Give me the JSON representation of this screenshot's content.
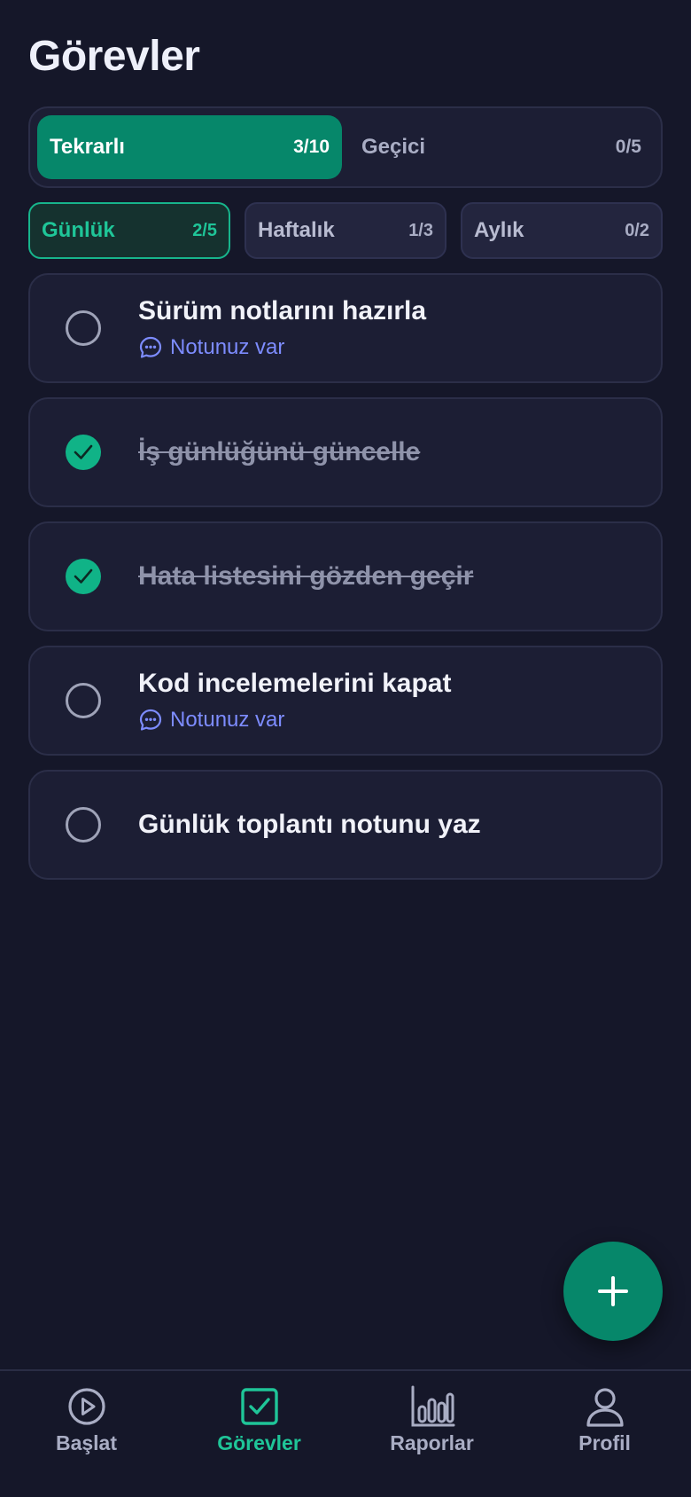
{
  "page": {
    "title": "Görevler"
  },
  "segments": [
    {
      "label": "Tekrarlı",
      "count": "3/10",
      "active": true
    },
    {
      "label": "Geçici",
      "count": "0/5",
      "active": false
    }
  ],
  "frequency_tabs": [
    {
      "label": "Günlük",
      "count": "2/5",
      "active": true
    },
    {
      "label": "Haftalık",
      "count": "1/3",
      "active": false
    },
    {
      "label": "Aylık",
      "count": "0/2",
      "active": false
    }
  ],
  "tasks": [
    {
      "title": "Sürüm notlarını hazırla",
      "done": false,
      "note": "Notunuz var"
    },
    {
      "title": "İş günlüğünü güncelle",
      "done": true,
      "note": ""
    },
    {
      "title": "Hata listesini gözden geçir",
      "done": true,
      "note": ""
    },
    {
      "title": "Kod incelemelerini kapat",
      "done": false,
      "note": "Notunuz var"
    },
    {
      "title": "Günlük toplantı notunu yaz",
      "done": false,
      "note": ""
    }
  ],
  "fab": {
    "icon": "plus-icon"
  },
  "bottom_nav": [
    {
      "label": "Başlat",
      "icon": "play-circle-icon",
      "active": false
    },
    {
      "label": "Görevler",
      "icon": "checkbox-icon",
      "active": true
    },
    {
      "label": "Raporlar",
      "icon": "bar-chart-icon",
      "active": false
    },
    {
      "label": "Profil",
      "icon": "user-icon",
      "active": false
    }
  ],
  "colors": {
    "background": "#151729",
    "accent": "#06876a",
    "accent_text": "#1fc598",
    "note_link": "#7d8cff",
    "card": "#1c1e34"
  }
}
